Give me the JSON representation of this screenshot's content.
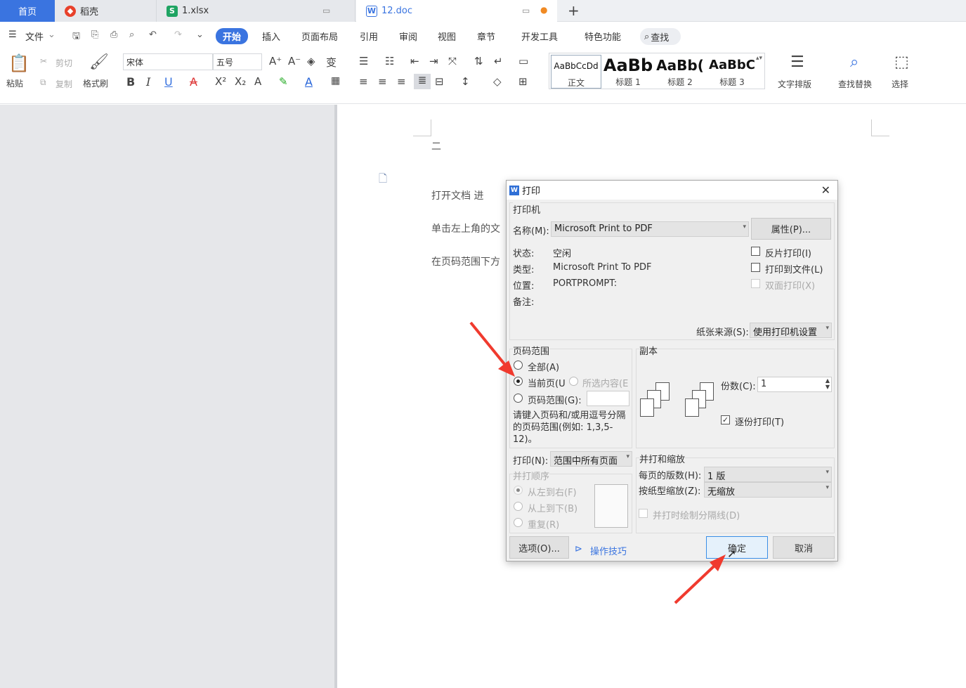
{
  "tabs": {
    "home": "首页",
    "daoke": "稻壳",
    "xlsx": "1.xlsx",
    "doc": "12.doc"
  },
  "menu": {
    "file": "文件",
    "start": "开始",
    "insert": "插入",
    "layout": "页面布局",
    "reference": "引用",
    "review": "审阅",
    "view": "视图",
    "section": "章节",
    "developer": "开发工具",
    "special": "特色功能",
    "search": "查找"
  },
  "ribbon": {
    "paste": "粘贴",
    "cut": "剪切",
    "copy": "复制",
    "format_painter": "格式刷",
    "font_name": "宋体",
    "font_size": "五号",
    "styles": [
      {
        "sample": "AaBbCcDd",
        "label": "正文"
      },
      {
        "sample": "AaBb",
        "label": "标题 1"
      },
      {
        "sample": "AaBb(",
        "label": "标题 2"
      },
      {
        "sample": "AaBbC",
        "label": "标题 3"
      }
    ],
    "text_layout": "文字排版",
    "find_replace": "查找替换",
    "select": "选择"
  },
  "document": {
    "line0": "二",
    "line1": "打开文档   进",
    "line2": "单击左上角的文",
    "line3": "在页码范围下方"
  },
  "dialog": {
    "title": "打印",
    "printer_group": "打印机",
    "name_label": "名称(M):",
    "printer_name": "Microsoft Print to PDF",
    "properties_btn": "属性(P)...",
    "status_label": "状态:",
    "status_value": "空闲",
    "type_label": "类型:",
    "type_value": "Microsoft Print To PDF",
    "location_label": "位置:",
    "location_value": "PORTPROMPT:",
    "comment_label": "备注:",
    "reverse_print": "反片打印(I)",
    "print_to_file": "打印到文件(L)",
    "duplex": "双面打印(X)",
    "paper_source_label": "纸张来源(S):",
    "paper_source_value": "使用打印机设置",
    "range_group": "页码范围",
    "range_all": "全部(A)",
    "range_current": "当前页(U",
    "range_selection": "所选内容(E",
    "range_pages": "页码范围(G):",
    "range_hint": "请键入页码和/或用逗号分隔的页码范围(例如: 1,3,5-12)。",
    "copies_group": "副本",
    "copies_label": "份数(C):",
    "copies_value": "1",
    "collate": "逐份打印(T)",
    "print_label": "打印(N):",
    "print_value": "范围中所有页面",
    "order_group": "并打顺序",
    "order_lr": "从左到右(F)",
    "order_tb": "从上到下(B)",
    "order_repeat": "重复(R)",
    "zoom_group": "并打和缩放",
    "pages_per_sheet_label": "每页的版数(H):",
    "pages_per_sheet_value": "1 版",
    "scale_label": "按纸型缩放(Z):",
    "scale_value": "无缩放",
    "draw_borders": "并打时绘制分隔线(D)",
    "options_btn": "选项(O)...",
    "tips_link": "操作技巧",
    "ok_btn": "确定",
    "cancel_btn": "取消"
  },
  "colors": {
    "accent": "#3a74e0",
    "annotation_arrow": "#f03a2e"
  }
}
